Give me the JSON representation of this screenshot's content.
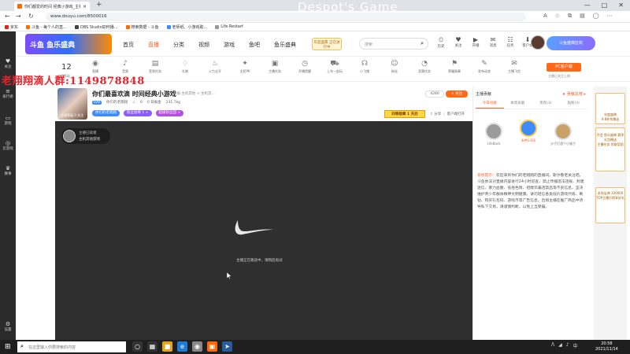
{
  "browser": {
    "tab_title": "你们都爱的时间 经典小游戏_主机其他游戏",
    "tab_close": "×",
    "new_tab": "+",
    "url": "www.douyu.com/8500016",
    "overlay_title": "Despot's Game",
    "window_controls": [
      "—",
      "□",
      "✕"
    ],
    "bookmarks": [
      {
        "label": "京东",
        "color": "#e1251b"
      },
      {
        "label": "斗鱼 - 每个人的直...",
        "color": "#ff6a00"
      },
      {
        "label": "OBS Studio如何播...",
        "color": "#444444"
      },
      {
        "label": "搜索数据 - 斗鱼",
        "color": "#ff6a00"
      },
      {
        "label": "老师纸、小游戏助...",
        "color": "#3d8bff"
      },
      {
        "label": "Life Restart",
        "color": "#999999"
      }
    ]
  },
  "sidebar": {
    "items": [
      {
        "icon": "♥",
        "label": "关注"
      },
      {
        "icon": "≡",
        "label": "排行榜"
      },
      {
        "icon": "▭",
        "label": "游戏"
      },
      {
        "icon": "◎",
        "label": "云游戏"
      },
      {
        "icon": "♛",
        "label": "赛事"
      },
      {
        "icon": "⚙",
        "label": "设置"
      }
    ]
  },
  "header": {
    "logo_text": "斗鱼 鱼乐盛典",
    "nav": [
      "首页",
      "直播",
      "分类",
      "视频",
      "游戏",
      "鱼吧",
      "鱼乐盛典"
    ],
    "nav_active": "直播",
    "live_badge": "年度盛典 正在进行中",
    "search_placeholder": "搜索",
    "search_icon": "⌕",
    "icons": [
      {
        "icon": "⏲",
        "label": "历史"
      },
      {
        "icon": "♥",
        "label": "关注"
      },
      {
        "icon": "▶",
        "label": "开播"
      },
      {
        "icon": "✉",
        "label": "消息"
      },
      {
        "icon": "☷",
        "label": "任务"
      },
      {
        "icon": "⬇",
        "label": "客户端"
      }
    ],
    "banner_text": "斗鱼盛典狂欢"
  },
  "toolbar": {
    "count": "12",
    "count_label": "主播等级",
    "tools": [
      {
        "icon": "◉",
        "label": "直播"
      },
      {
        "icon": "♪",
        "label": "音频"
      },
      {
        "icon": "▤",
        "label": "签到任务"
      },
      {
        "icon": "♢",
        "label": "礼物"
      },
      {
        "icon": "♨",
        "label": "火力全开"
      },
      {
        "icon": "✦",
        "label": "全民PK"
      },
      {
        "icon": "▣",
        "label": "主播任务"
      },
      {
        "icon": "◷",
        "label": "开播提醒"
      },
      {
        "icon": "⛟",
        "label": "上车一起玩"
      },
      {
        "icon": "☊",
        "label": "小飞猪"
      },
      {
        "icon": "☺",
        "label": "粉丝"
      },
      {
        "icon": "◔",
        "label": "竞猜任务"
      },
      {
        "icon": "⚑",
        "label": "荣耀勋章"
      },
      {
        "icon": "✎",
        "label": "发布动态"
      },
      {
        "icon": "✉",
        "label": "主播飞信"
      }
    ],
    "pc_button": "PC客户端",
    "pc_sub": "主播已关注上线"
  },
  "overlay_qq": "老翔翔滴人群:1149878848",
  "room": {
    "title": "你们最喜欢滴 时间经典小游戏",
    "meta": "举报  主机其他 > 主机其...",
    "anchor_name": "你们的老翔翔",
    "level": "LV8",
    "heat": "6",
    "fans": "0 日报金",
    "views": "231.7kg",
    "avatar_label": "主播等级 0 关注",
    "tags": [
      {
        "label": "你们的老翔翔",
        "color": "#3d8bff"
      },
      {
        "label": "粉丝勋章 1 +",
        "color": "#8a5cff"
      },
      {
        "label": "超级粉丝团 >",
        "color": "#b350e0"
      }
    ],
    "follow_count": "4280",
    "follow_label": "+ 关注",
    "promo": "四等勋章 1 天后",
    "share": "⇪ 分享   ⋮ 客户端打开"
  },
  "player": {
    "badge_title": "主播已就绪",
    "badge_sub": "主机其他游戏",
    "message": "主播正在路途中，请稍后再试"
  },
  "right_panel": {
    "rank_title": "主播贡献",
    "rank_sub": "★ 贡献总榜 ▸",
    "tabs": [
      "今日贡献",
      "本周贡献",
      "贵宾(3)",
      "贴粉(4)"
    ],
    "top3": [
      {
        "name": "LifeBack",
        "color": "#9b9b9b"
      },
      {
        "name": "朱鸭1416",
        "color": "#3d8bff"
      },
      {
        "name": "沙子打酒个小猫子",
        "color": "#c7a36a"
      }
    ],
    "chat_sys": "系统提示：",
    "chat_text": "欢迎来到你们的老翔翔的直播间。斯尔敬老关注吧。斗鱼依法对直播内容进行24小时巡查，禁止传播违法违规、封建迷信、暴力血腥、低俗色情、招嫖诈骗违禁品等不良信息，坚决维护青少年群体精神文明健康。请勿轻信各类低价游戏代练、刷钻、购买礼包码、游戏币等广告信息，且如主播在推广商品中诱导私下交易，请谨慎判断，以免上当受骗。"
  },
  "ads": [
    {
      "title": "年度盛典",
      "body": "9.8秒杀赠送"
    },
    {
      "title": "开会 鱼乐盛典 赛季礼包赠送",
      "body": "主播任务 领取奖励"
    },
    {
      "title": "本场宝典 100000",
      "body": "TOP主播打榜享好礼"
    }
  ],
  "taskbar": {
    "start_icon": "⊞",
    "search_placeholder": "在这里输入你要搜索的内容",
    "search_icon": "⌕",
    "apps": [
      {
        "icon": "○",
        "color": "#333333"
      },
      {
        "icon": "▦",
        "color": "#333333"
      },
      {
        "icon": "■",
        "color": "#e8a317"
      },
      {
        "icon": "e",
        "color": "#1c7cd6"
      },
      {
        "icon": "◉",
        "color": "#888888"
      },
      {
        "icon": "▣",
        "color": "#ff6a00"
      },
      {
        "icon": "➤",
        "color": "#2a5b9c"
      }
    ],
    "tray": [
      "ᐱ",
      "◢",
      "♪",
      "中"
    ],
    "time": "20:58",
    "date": "2021/11/14"
  }
}
